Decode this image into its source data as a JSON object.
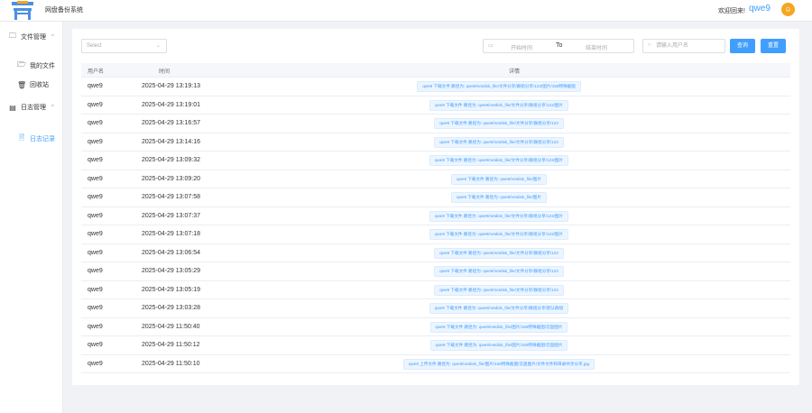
{
  "header": {
    "app_title": "网盘备份系统",
    "welcome_text": "欢迎回来!",
    "username": "qwe9",
    "avatar_glyph": "☺"
  },
  "sidebar": {
    "items": [
      {
        "label": "文件管理",
        "icon": "folder-icon",
        "glyph": "🗀",
        "arrow": "^"
      },
      {
        "label": "我的文件",
        "icon": "folder-open-icon",
        "glyph": "🗁"
      },
      {
        "label": "回收站",
        "icon": "trash-icon",
        "glyph": "🗑"
      },
      {
        "label": "日志管理",
        "icon": "log-icon",
        "glyph": "▤",
        "arrow": "^"
      },
      {
        "label": "日志记录",
        "icon": "document-icon",
        "glyph": "🗎",
        "active": true
      }
    ]
  },
  "toolbar": {
    "select_placeholder": "Select",
    "start_placeholder": "开始时间",
    "to_label": "To",
    "end_placeholder": "结束时间",
    "search_placeholder": "请输入用户名",
    "query_label": "查询",
    "reset_label": "重置"
  },
  "table": {
    "columns": [
      "用户名",
      "时间",
      "详情"
    ],
    "rows": [
      {
        "user": "qwe9",
        "time": "2025-04-29 13:19:13",
        "detail": "qwe9 下载文件 路径为: qwe9/netdisk_file/文件分享/群组分享/123/图片/158特殊截图"
      },
      {
        "user": "qwe9",
        "time": "2025-04-29 13:19:01",
        "detail": "qwe9 下载文件 路径为: qwe9/netdisk_file/文件分享/群组分享/123/图片"
      },
      {
        "user": "qwe9",
        "time": "2025-04-29 13:16:57",
        "detail": "qwe9 下载文件 路径为: qwe9/netdisk_file/文件分享/群组分享/123"
      },
      {
        "user": "qwe9",
        "time": "2025-04-29 13:14:16",
        "detail": "qwe9 下载文件 路径为: qwe9/netdisk_file/文件分享/群组分享/123"
      },
      {
        "user": "qwe9",
        "time": "2025-04-29 13:09:32",
        "detail": "qwe9 下载文件 路径为: qwe9/netdisk_file/文件分享/群组分享/123/图片"
      },
      {
        "user": "qwe9",
        "time": "2025-04-29 13:09:20",
        "detail": "qwe9 下载文件 路径为: qwe9/netdisk_file/图片"
      },
      {
        "user": "qwe9",
        "time": "2025-04-29 13:07:58",
        "detail": "qwe9 下载文件 路径为: qwe9/netdisk_file/图片"
      },
      {
        "user": "qwe9",
        "time": "2025-04-29 13:07:37",
        "detail": "qwe9 下载文件 路径为: qwe9/netdisk_file/文件分享/群组分享/123/图片"
      },
      {
        "user": "qwe9",
        "time": "2025-04-29 13:07:18",
        "detail": "qwe9 下载文件 路径为: qwe9/netdisk_file/文件分享/群组分享/123/图片"
      },
      {
        "user": "qwe9",
        "time": "2025-04-29 13:06:54",
        "detail": "qwe9 下载文件 路径为: qwe9/netdisk_file/文件分享/群组分享/123"
      },
      {
        "user": "qwe9",
        "time": "2025-04-29 13:05:29",
        "detail": "qwe9 下载文件 路径为: qwe9/netdisk_file/文件分享/群组分享/123"
      },
      {
        "user": "qwe9",
        "time": "2025-04-29 13:05:19",
        "detail": "qwe9 下载文件 路径为: qwe9/netdisk_file/文件分享/群组分享/123"
      },
      {
        "user": "qwe9",
        "time": "2025-04-29 13:03:28",
        "detail": "qwe9 下载文件 路径为: qwe9/netdisk_file/文件分享/群组分享/默认群组"
      },
      {
        "user": "qwe9",
        "time": "2025-04-29 11:50:40",
        "detail": "qwe9 下载文件 路径为: qwe9/netdisk_file/图片/158特殊截图/云盘图片"
      },
      {
        "user": "qwe9",
        "time": "2025-04-29 11:50:12",
        "detail": "qwe9 下载文件 路径为: qwe9/netdisk_file/图片/158特殊截图/云盘图片"
      },
      {
        "user": "qwe9",
        "time": "2025-04-29 11:50:10",
        "detail": "qwe9 上传文件 路径为: qwe9/netdisk_file/图片/158特殊截图/云盘图片/文件文件和目录共享分享.jpg"
      }
    ]
  },
  "colors": {
    "accent": "#409eff",
    "avatar": "#f5a623",
    "background": "#f0f2f5"
  }
}
